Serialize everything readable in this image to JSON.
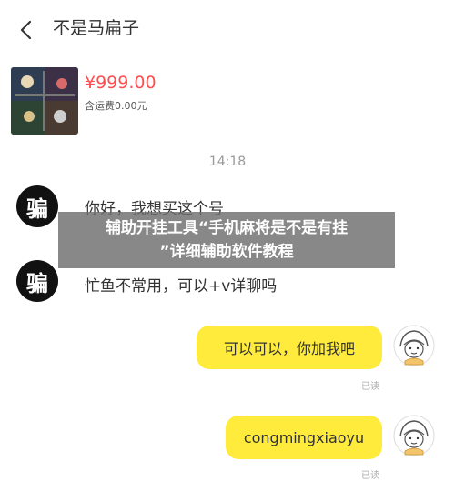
{
  "header": {
    "title": "不是马扁子"
  },
  "product": {
    "price": "¥999.00",
    "shipping": "含运费0.00元"
  },
  "chat": {
    "time": "14:18",
    "messages": [
      {
        "side": "left",
        "avatar_text": "骗",
        "text": "你好，我想买这个号"
      },
      {
        "side": "left",
        "avatar_text": "骗",
        "text": "忙鱼不常用，可以+v详聊吗"
      },
      {
        "side": "right",
        "text": "可以可以，你加我吧",
        "status": "已读"
      },
      {
        "side": "right",
        "text": "congmingxiaoyu",
        "status": "已读"
      }
    ]
  },
  "overlay": {
    "line1": "辅助开挂工具“手机麻将是不是有挂",
    "line2": "”详细辅助软件教程"
  },
  "colors": {
    "bubble": "#ffeb3b",
    "price": "#ff4d4f",
    "overlay": "#6e6e6e"
  },
  "icons": {
    "back": "chevron-left-icon"
  }
}
